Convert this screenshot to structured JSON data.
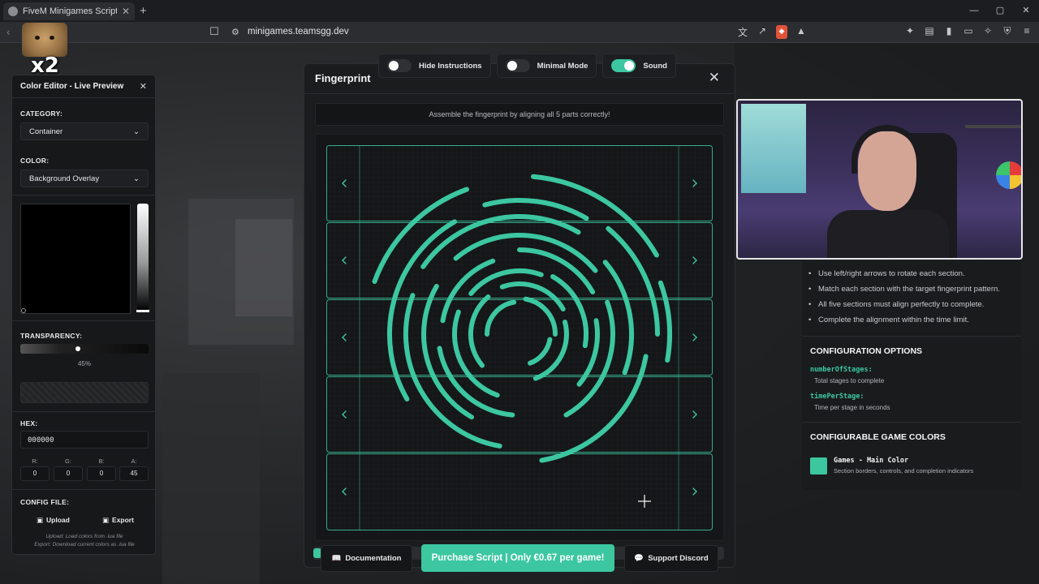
{
  "browser": {
    "tab_title": "FiveM Minigames Script - Intera",
    "new_tab": "+",
    "url": "minigames.teamsgg.dev",
    "window_controls": [
      "—",
      "▢",
      "✕"
    ]
  },
  "sticker": {
    "multiplier": "x2"
  },
  "color_editor": {
    "title": "Color Editor - Live Preview",
    "close": "✕",
    "category_label": "CATEGORY:",
    "category_value": "Container",
    "color_label": "COLOR:",
    "color_value": "Background Overlay",
    "transparency_label": "TRANSPARENCY:",
    "transparency_pct": "45%",
    "hex_label": "HEX:",
    "hex_value": "000000",
    "rgba": [
      {
        "label": "R:",
        "value": "0"
      },
      {
        "label": "G:",
        "value": "0"
      },
      {
        "label": "B:",
        "value": "0"
      },
      {
        "label": "A:",
        "value": "45"
      }
    ],
    "config_label": "CONFIG FILE:",
    "upload_label": "Upload",
    "export_label": "Export",
    "note_upload": "Upload: Load colors from .lua file",
    "note_export": "Export: Download current colors as .lua file"
  },
  "toggles": [
    {
      "label": "Hide Instructions",
      "on": false
    },
    {
      "label": "Minimal Mode",
      "on": false
    },
    {
      "label": "Sound",
      "on": true
    }
  ],
  "game": {
    "title": "Fingerprint",
    "close": "✕",
    "instructions": "Assemble the fingerprint by aligning all 5 parts correctly!",
    "sections": 5,
    "accent_color": "#3cc7a1"
  },
  "footer": {
    "documentation": "Documentation",
    "purchase": "Purchase Script | Only €0.67 per game!",
    "discord": "Support Discord"
  },
  "info": {
    "bullets": [
      "Use left/right arrows to rotate each section.",
      "Match each section with the target fingerprint pattern.",
      "All five sections must align perfectly to complete.",
      "Complete the alignment within the time limit."
    ],
    "config_heading": "CONFIGURATION OPTIONS",
    "options": [
      {
        "key": "numberOfStages:",
        "desc": "Total stages to complete"
      },
      {
        "key": "timePerStage:",
        "desc": "Time per stage in seconds"
      }
    ],
    "colors_heading": "CONFIGURABLE GAME COLORS",
    "color_name": "Games - Main Color",
    "color_desc": "Section borders, controls, and completion indicators",
    "swatch_color": "#3cc7a1"
  }
}
